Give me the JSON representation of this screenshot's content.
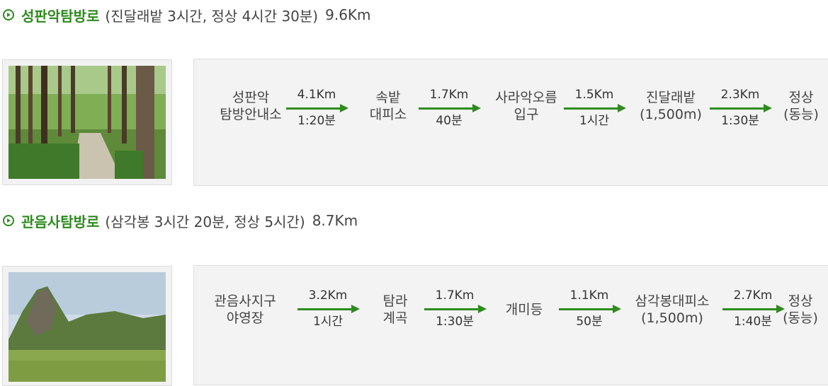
{
  "trails": [
    {
      "name": "성판악탐방로",
      "detail": "(진달래밭 3시간, 정상 4시간 30분)",
      "distance": "9.6Km",
      "photo": "forest-path-photo",
      "stops": [
        {
          "line1": "성판악",
          "line2": "탐방안내소"
        },
        {
          "line1": "속밭",
          "line2": "대피소"
        },
        {
          "line1": "사라악오름",
          "line2": "입구"
        },
        {
          "line1": "진달래밭",
          "line2": "(1,500m)"
        },
        {
          "line1": "정상",
          "line2": "(동능)"
        }
      ],
      "segments": [
        {
          "distance": "4.1Km",
          "time": "1:20분"
        },
        {
          "distance": "1.7Km",
          "time": "40분"
        },
        {
          "distance": "1.5Km",
          "time": "1시간"
        },
        {
          "distance": "2.3Km",
          "time": "1:30분"
        }
      ]
    },
    {
      "name": "관음사탐방로",
      "detail": "(삼각봉 3시간 20분, 정상 5시간)",
      "distance": "8.7Km",
      "photo": "mountain-peak-photo",
      "stops": [
        {
          "line1": "관음사지구",
          "line2": "야영장"
        },
        {
          "line1": "탐라",
          "line2": "계곡"
        },
        {
          "line1": "개미등",
          "line2": ""
        },
        {
          "line1": "삼각봉대피소",
          "line2": "(1,500m)"
        },
        {
          "line1": "정상",
          "line2": "(동능)"
        }
      ],
      "segments": [
        {
          "distance": "3.2Km",
          "time": "1시간"
        },
        {
          "distance": "1.7Km",
          "time": "1:30분"
        },
        {
          "distance": "1.1Km",
          "time": "50분"
        },
        {
          "distance": "2.7Km",
          "time": "1:40분"
        }
      ]
    }
  ],
  "colors": {
    "trail_name": "#2e8b1e",
    "arrow": "#2e8b1e",
    "route_box_bg": "#f3f3f3"
  }
}
